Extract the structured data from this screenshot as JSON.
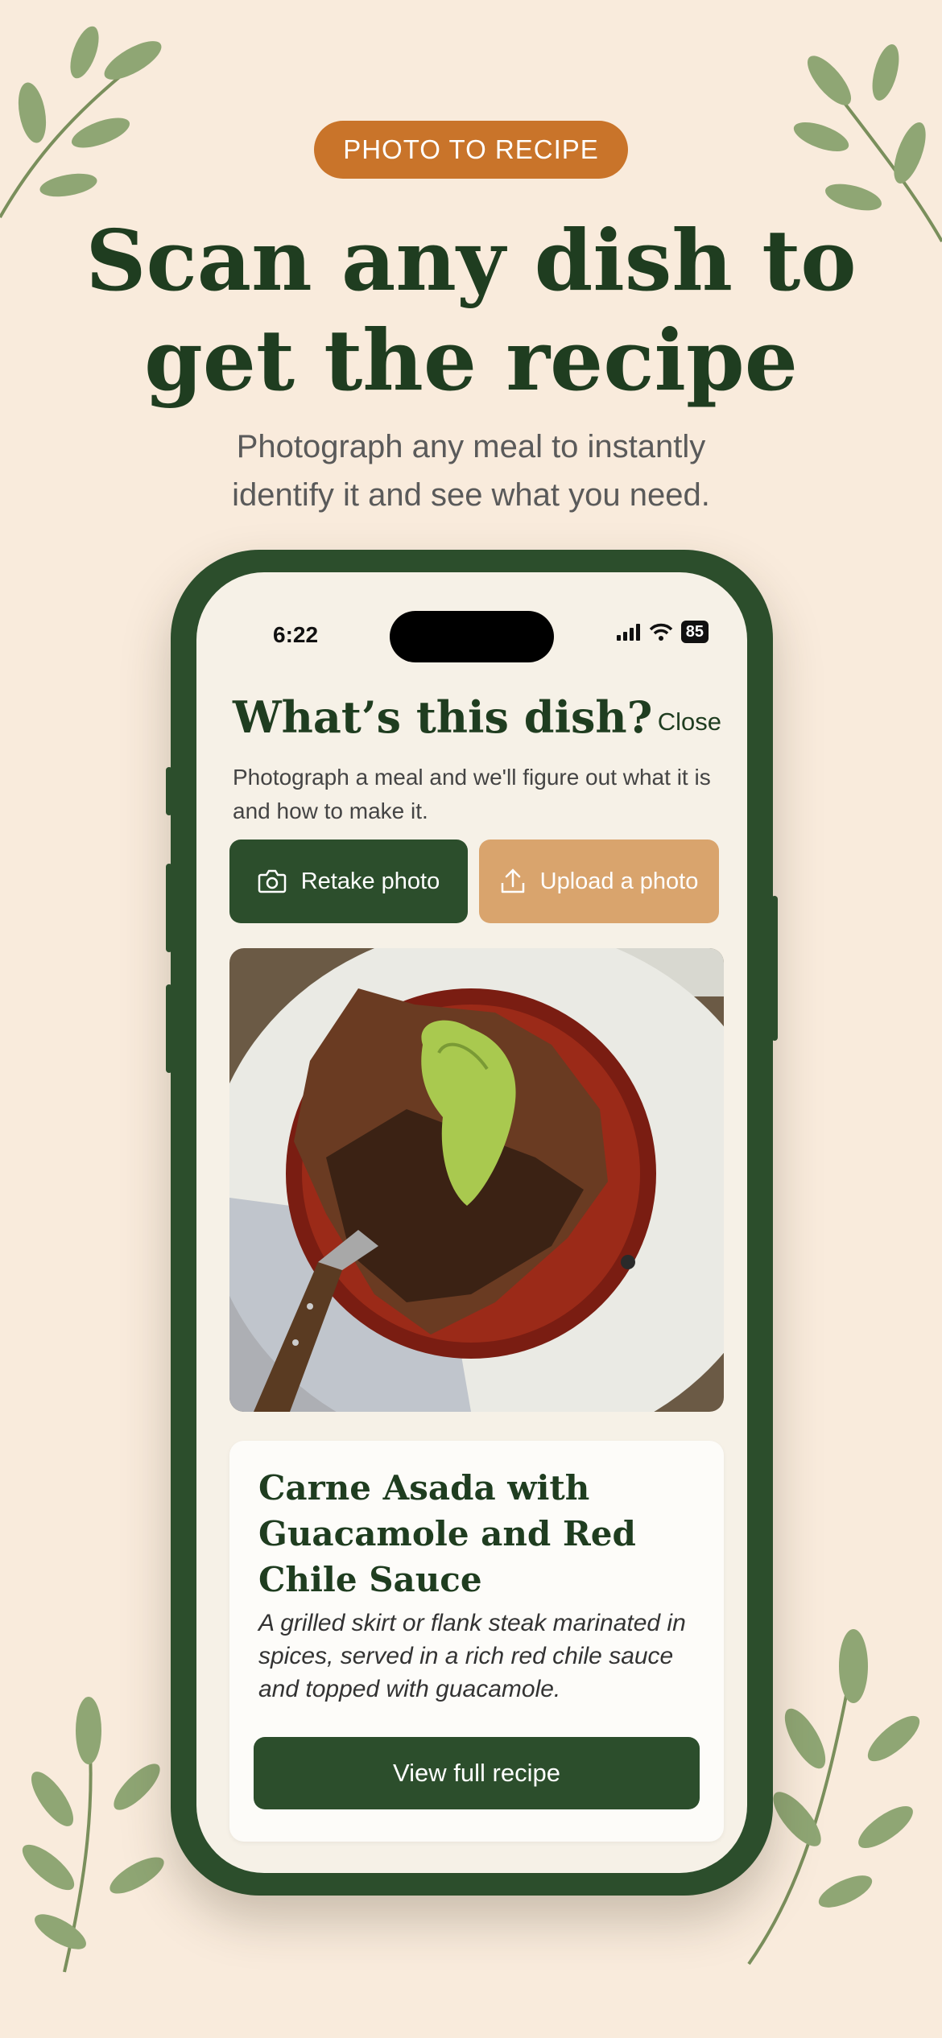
{
  "promo": {
    "badge": "PHOTO TO RECIPE",
    "headline_line1": "Scan any dish to",
    "headline_line2": "get the recipe",
    "subhead_line1": "Photograph any meal to instantly",
    "subhead_line2": "identify it and see what you need."
  },
  "status_bar": {
    "time": "6:22",
    "battery": "85"
  },
  "screen": {
    "title": "What’s this dish?",
    "close_label": "Close",
    "description": "Photograph a meal and we'll figure out what it is and how to make it.",
    "retake_label": "Retake photo",
    "upload_label": "Upload a photo"
  },
  "result": {
    "name": "Carne Asada with Guacamole and Red Chile Sauce",
    "description": "A grilled skirt or flank steak marinated in spices, served in a rich red chile sauce and topped with guacamole.",
    "view_label": "View full recipe"
  },
  "icons": {
    "camera": "camera-icon",
    "upload": "upload-icon",
    "signal": "signal-icon",
    "wifi": "wifi-icon",
    "leaf": "leaf-branch-icon"
  },
  "colors": {
    "background": "#f9ebdc",
    "brand_green": "#2c4e2c",
    "badge_orange": "#c9742a",
    "upload_tan": "#d9a46d"
  }
}
